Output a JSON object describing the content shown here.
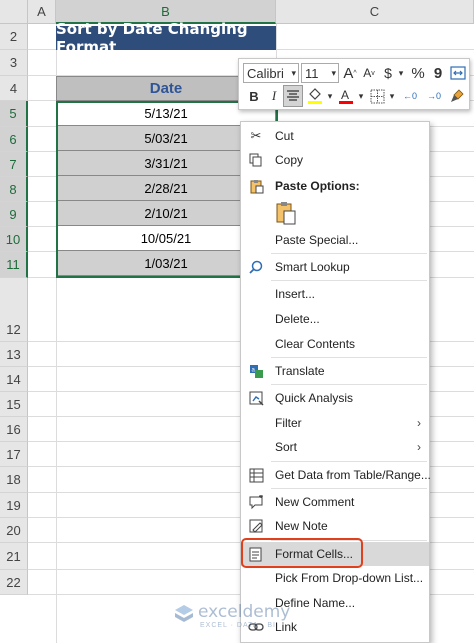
{
  "columns": [
    "A",
    "B",
    "C"
  ],
  "rows": [
    "2",
    "3",
    "4",
    "5",
    "6",
    "7",
    "8",
    "9",
    "10",
    "11",
    "12",
    "13",
    "14",
    "15",
    "16",
    "17",
    "18",
    "19",
    "20",
    "21",
    "22"
  ],
  "title": "Sort by Date Changing Format",
  "table": {
    "header": "Date",
    "values": [
      "5/13/21",
      "5/03/21",
      "3/31/21",
      "2/28/21",
      "2/10/21",
      "10/05/21",
      "1/03/21"
    ]
  },
  "toolbar": {
    "font_name": "Calibri",
    "font_size": "11",
    "grow_font": "A",
    "shrink_font": "A",
    "currency": "$",
    "percent": "%",
    "comma": "9",
    "bold": "B",
    "italic": "I",
    "fill_color": "#ffff00",
    "font_color": "#ff0000",
    "inc_decimal": "←0",
    "dec_decimal": "→0"
  },
  "context_menu": {
    "cut": "Cut",
    "copy": "Copy",
    "paste_options": "Paste Options:",
    "paste_special": "Paste Special...",
    "smart_lookup": "Smart Lookup",
    "insert": "Insert...",
    "delete": "Delete...",
    "clear_contents": "Clear Contents",
    "translate": "Translate",
    "quick_analysis": "Quick Analysis",
    "filter": "Filter",
    "sort": "Sort",
    "get_data": "Get Data from Table/Range...",
    "new_comment": "New Comment",
    "new_note": "New Note",
    "format_cells": "Format Cells...",
    "pick_list": "Pick From Drop-down List...",
    "define_name": "Define Name...",
    "link": "Link"
  },
  "watermark": {
    "brand": "exceldemy",
    "tagline": "EXCEL · DATA · BI"
  },
  "colors": {
    "title_bg": "#2f4d7a",
    "header_text": "#2f5597",
    "selection_green": "#217346",
    "highlight_red": "#e0401c"
  }
}
